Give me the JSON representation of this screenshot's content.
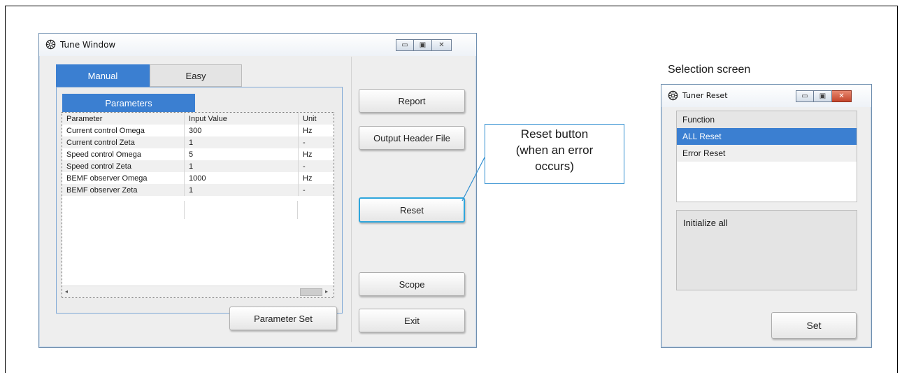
{
  "caption": "Selection screen",
  "callout": {
    "line1": "Reset button",
    "line2": "(when an error",
    "line3": "occurs)"
  },
  "tune_window": {
    "title": "Tune Window",
    "tabs": [
      {
        "label": "Manual",
        "active": true
      },
      {
        "label": "Easy",
        "active": false
      }
    ],
    "subtab_label": "Parameters",
    "table": {
      "headers": [
        "Parameter",
        "Input Value",
        "Unit"
      ],
      "rows": [
        [
          "Current control Omega",
          "300",
          "Hz"
        ],
        [
          "Current control Zeta",
          "1",
          "-"
        ],
        [
          "Speed control Omega",
          "5",
          "Hz"
        ],
        [
          "Speed control Zeta",
          "1",
          "-"
        ],
        [
          "BEMF observer Omega",
          "1000",
          "Hz"
        ],
        [
          "BEMF observer Zeta",
          "1",
          "-"
        ]
      ]
    },
    "buttons": {
      "report": "Report",
      "output_header": "Output Header File",
      "reset": "Reset",
      "scope": "Scope",
      "exit": "Exit",
      "parameter_set": "Parameter Set"
    }
  },
  "tuner_reset_window": {
    "title": "Tuner Reset",
    "function_header": "Function",
    "options": [
      "ALL Reset",
      "Error Reset"
    ],
    "selected": "ALL Reset",
    "description": "Initialize all",
    "set_button": "Set"
  },
  "colors": {
    "accent": "#3b7fd1",
    "callout_border": "#2f8ed0",
    "window_bg": "#eeeeee"
  }
}
